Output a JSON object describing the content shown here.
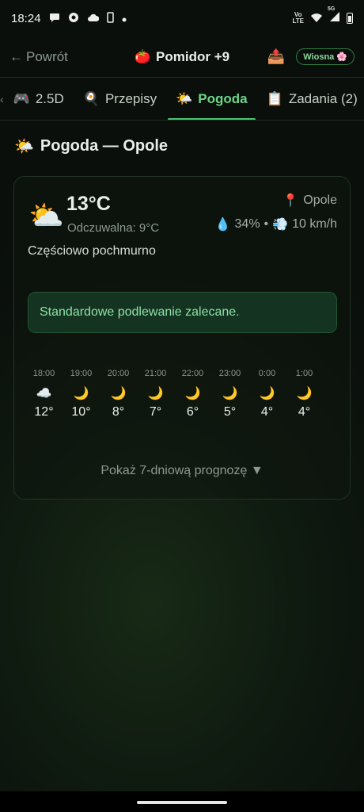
{
  "status_bar": {
    "time": "18:24",
    "left_icons": [
      "chat-bubble-icon",
      "chrome-icon",
      "cloud-icon",
      "phone-icon",
      "dot-icon"
    ],
    "volte": "Vo",
    "lte": "LTE",
    "network": "5G",
    "right_icons": [
      "wifi-icon",
      "signal-icon",
      "battery-icon"
    ]
  },
  "header": {
    "back_label": "Powrót",
    "back_arrow": "←",
    "plant_emoji": "🍅",
    "title": "Pomidor +9",
    "export_emoji": "📤",
    "season_label": "Wiosna",
    "season_emoji": "🌸"
  },
  "tabs": [
    {
      "emoji": "🎮",
      "label": "2.5D",
      "active": false
    },
    {
      "emoji": "🍳",
      "label": "Przepisy",
      "active": false
    },
    {
      "emoji": "🌤️",
      "label": "Pogoda",
      "active": true
    },
    {
      "emoji": "📋",
      "label": "Zadania (2)",
      "active": false
    }
  ],
  "section": {
    "emoji": "🌤️",
    "title": "Pogoda — Opole"
  },
  "current": {
    "icon_emoji": "⛅",
    "temperature": "13°C",
    "feels_like": "Odczuwalna: 9°C",
    "location_emoji": "📍",
    "location": "Opole",
    "humidity_emoji": "💧",
    "humidity": "34%",
    "separator": "•",
    "wind_emoji": "💨",
    "wind": "10 km/h",
    "condition": "Częściowo pochmurno"
  },
  "advice": {
    "text": "Standardowe podlewanie zalecane."
  },
  "hourly": [
    {
      "time": "18:00",
      "icon": "☁️",
      "temp": "12°"
    },
    {
      "time": "19:00",
      "icon": "🌙",
      "temp": "10°"
    },
    {
      "time": "20:00",
      "icon": "🌙",
      "temp": "8°"
    },
    {
      "time": "21:00",
      "icon": "🌙",
      "temp": "7°"
    },
    {
      "time": "22:00",
      "icon": "🌙",
      "temp": "6°"
    },
    {
      "time": "23:00",
      "icon": "🌙",
      "temp": "5°"
    },
    {
      "time": "0:00",
      "icon": "🌙",
      "temp": "4°"
    },
    {
      "time": "1:00",
      "icon": "🌙",
      "temp": "4°"
    }
  ],
  "forecast_toggle": {
    "label": "Pokaż 7-dniową prognozę",
    "arrow": "▼"
  },
  "colors": {
    "accent": "#47c36e",
    "background": "#0b110c"
  }
}
